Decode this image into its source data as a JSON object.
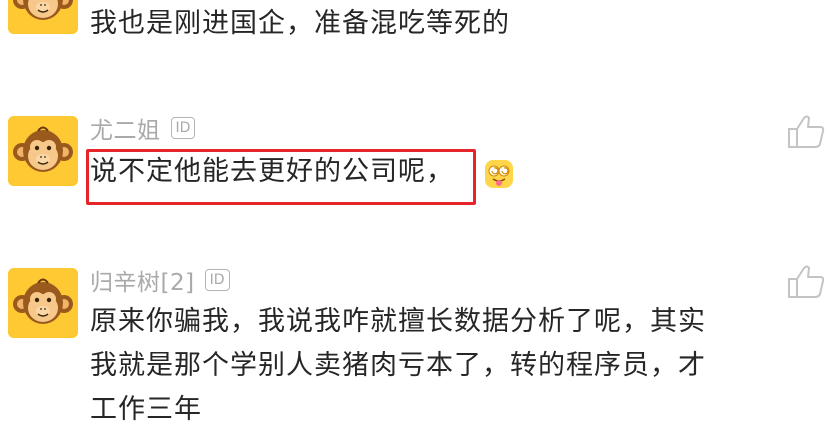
{
  "comments": [
    {
      "username": "",
      "badge": "",
      "text_lines": [
        "我也是刚进国企，准备混吃等死的"
      ],
      "avatar_icon": "monkey-avatar-icon"
    },
    {
      "username": "尤二姐",
      "badge": "ID",
      "text_lines": [
        "说不定他能去更好的公司呢，"
      ],
      "emoji_icon": "dizzy-tongue-emoji-icon",
      "avatar_icon": "monkey-avatar-icon",
      "like_icon": "thumbs-up-icon"
    },
    {
      "username": "归辛树[2]",
      "badge": "ID",
      "text_lines": [
        "原来你骗我，我说我咋就擅长数据分析了呢，其实",
        "我就是那个学别人卖猪肉亏本了，转的程序员，才",
        "工作三年"
      ],
      "avatar_icon": "monkey-avatar-icon",
      "like_icon": "thumbs-up-icon"
    }
  ],
  "colors": {
    "avatar_bg": "#ffc933",
    "highlight": "#e5252a",
    "username": "#a9a9a9",
    "text": "#262626"
  }
}
